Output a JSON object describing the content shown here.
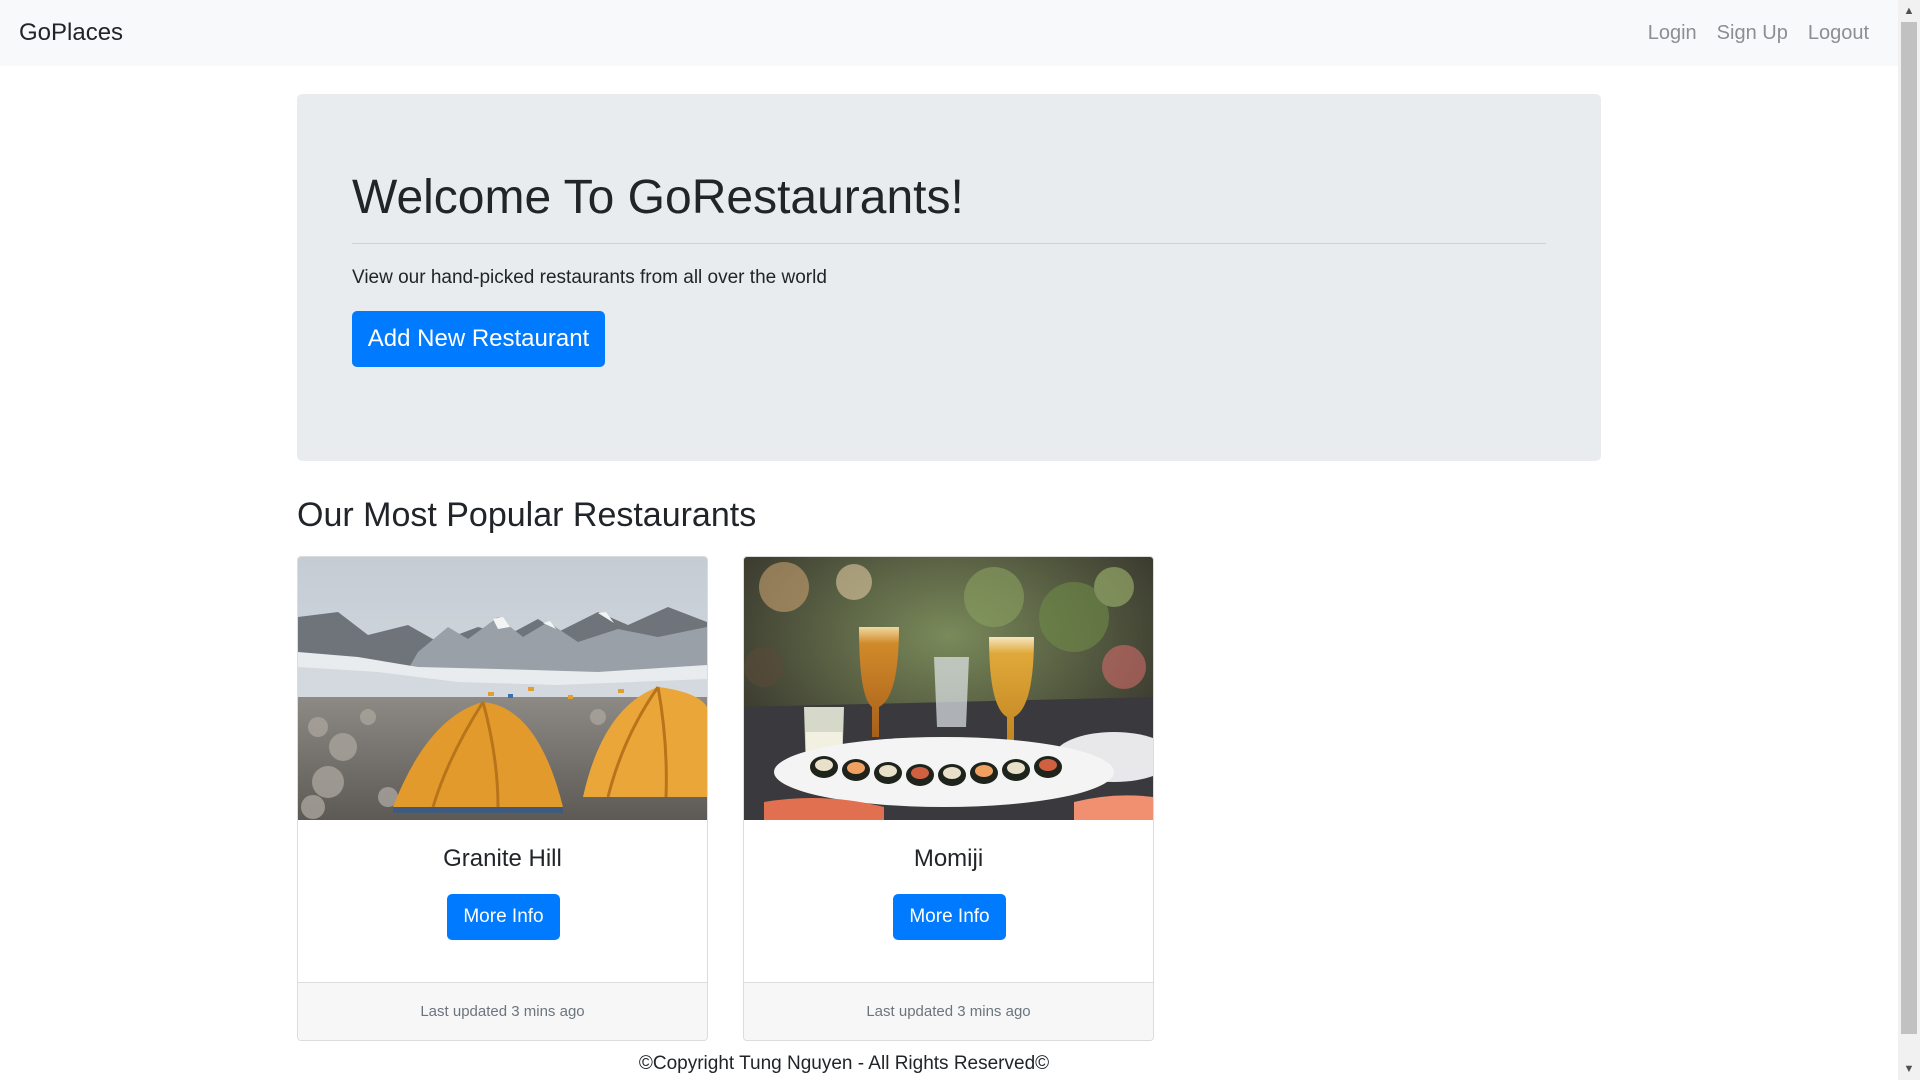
{
  "navbar": {
    "brand": "GoPlaces",
    "links": [
      {
        "label": "Login"
      },
      {
        "label": "Sign Up"
      },
      {
        "label": "Logout"
      }
    ]
  },
  "jumbotron": {
    "title": "Welcome To GoRestaurants!",
    "lead": "View our hand-picked restaurants from all over the world",
    "button_label": "Add New Restaurant"
  },
  "section": {
    "title": "Our Most Popular Restaurants"
  },
  "cards": [
    {
      "title": "Granite Hill",
      "button_label": "More Info",
      "footer": "Last updated 3 mins ago",
      "image_icon": "mountain-camp-photo"
    },
    {
      "title": "Momiji",
      "button_label": "More Info",
      "footer": "Last updated 3 mins ago",
      "image_icon": "sushi-drinks-photo"
    }
  ],
  "footer": {
    "text": "©Copyright Tung Nguyen - All Rights Reserved©"
  },
  "colors": {
    "primary": "#007bff",
    "jumbotron_bg": "#e9ecef",
    "navbar_bg": "#f8f9fa"
  }
}
